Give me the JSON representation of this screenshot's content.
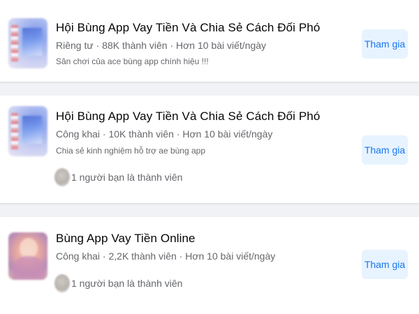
{
  "groups": [
    {
      "name": "Hội Bùng App Vay Tiền Và Chia Sẻ Cách Đối Phó",
      "meta": "Riêng tư · 88K thành viên · Hơn 10 bài viết/ngày",
      "description": "Sân chơi của ace bùng app chính hiệu !!!",
      "friends_text": "",
      "join_label": "Tham gia",
      "thumbnail": "blurred-phone-screenshot"
    },
    {
      "name": "Hội Bùng App Vay Tiền Và Chia Sẻ Cách Đối Phó",
      "meta": "Công khai · 10K thành viên · Hơn 10 bài viết/ngày",
      "description": "Chia sẻ kinh nghiệm hỗ trợ ae bùng app",
      "friends_text": "1 người bạn là thành viên",
      "join_label": "Tham gia",
      "thumbnail": "blurred-phone-screenshot"
    },
    {
      "name": "Bùng App Vay Tiền Online",
      "meta": "Công khai · 2,2K thành viên · Hơn 10 bài viết/ngày",
      "description": "",
      "friends_text": "1 người bạn là thành viên",
      "join_label": "Tham gia",
      "thumbnail": "blurred-person-photo"
    }
  ],
  "colors": {
    "page_background": "#f0f2f5",
    "card_background": "#ffffff",
    "secondary_text": "#65676b",
    "button_background": "#e7f3ff",
    "button_text": "#1877f2"
  }
}
